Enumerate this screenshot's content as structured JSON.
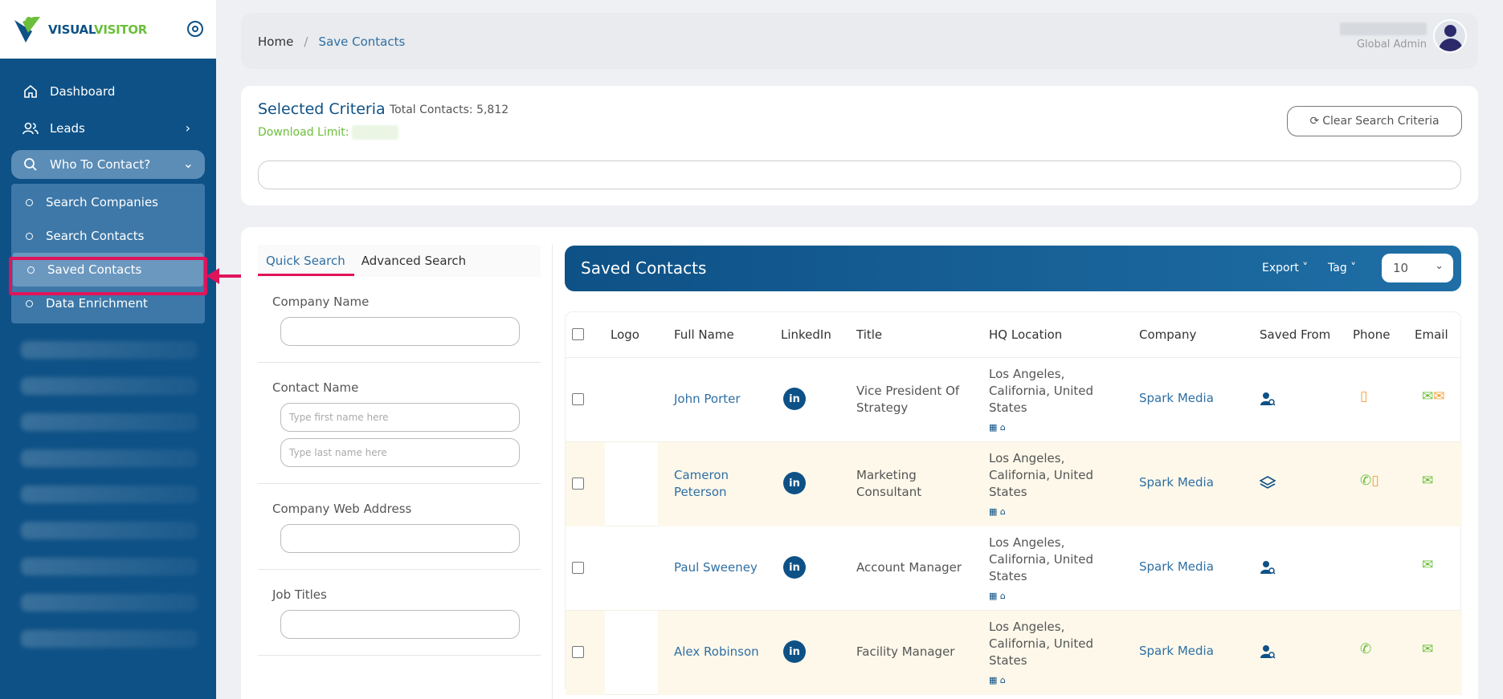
{
  "brand": {
    "part1": "VISUAL",
    "part2": "VISITOR"
  },
  "sidebar": {
    "items": [
      {
        "label": "Dashboard",
        "icon": "home-icon"
      },
      {
        "label": "Leads",
        "icon": "users-icon"
      },
      {
        "label": "Who To Contact?",
        "icon": "search-icon"
      }
    ],
    "subitems": [
      {
        "label": "Search Companies"
      },
      {
        "label": "Search Contacts"
      },
      {
        "label": "Saved Contacts",
        "active": true
      },
      {
        "label": "Data Enrichment"
      }
    ]
  },
  "breadcrumb": {
    "home": "Home",
    "separator": "/",
    "current": "Save Contacts"
  },
  "user": {
    "role": "Global Admin"
  },
  "criteria": {
    "title": "Selected Criteria",
    "total": "Total Contacts: 5,812",
    "download_limit": "Download Limit:",
    "clear_button": "Clear Search Criteria"
  },
  "search": {
    "tabs": [
      "Quick Search",
      "Advanced Search"
    ],
    "company_name_label": "Company Name",
    "contact_name_label": "Contact Name",
    "first_name_placeholder": "Type first name here",
    "last_name_placeholder": "Type last name here",
    "web_address_label": "Company Web Address",
    "job_titles_label": "Job Titles"
  },
  "results": {
    "title": "Saved Contacts",
    "export_label": "Export",
    "tag_label": "Tag",
    "page_size": "10",
    "columns": [
      "Logo",
      "Full Name",
      "LinkedIn",
      "Title",
      "HQ Location",
      "Company",
      "Saved From",
      "Phone",
      "Email"
    ],
    "rows": [
      {
        "name": "John Porter",
        "title": "Vice President Of Strategy",
        "location": "Los Angeles, California, United States",
        "company": "Spark Media",
        "saved_from": "contact-search-icon",
        "phone": [
          "mobile-icon"
        ],
        "email": [
          "email-icon",
          "email-icon"
        ]
      },
      {
        "name": "Cameron Peterson",
        "title": "Marketing Consultant",
        "location": "Los Angeles, California, United States",
        "company": "Spark Media",
        "saved_from": "layers-icon",
        "phone": [
          "phone-icon",
          "mobile-icon"
        ],
        "email": [
          "email-icon"
        ]
      },
      {
        "name": "Paul Sweeney",
        "title": "Account Manager",
        "location": "Los Angeles, California, United States",
        "company": "Spark Media",
        "saved_from": "contact-search-icon",
        "phone": [],
        "email": [
          "email-icon"
        ]
      },
      {
        "name": "Alex Robinson",
        "title": "Facility Manager",
        "location": "Los Angeles, California, United States",
        "company": "Spark Media",
        "saved_from": "contact-search-icon",
        "phone": [
          "phone-icon"
        ],
        "email": [
          "email-icon"
        ]
      }
    ]
  },
  "colors": {
    "primary": "#0e5186",
    "accent": "#6bbf3a",
    "highlight": "#e0145a"
  }
}
